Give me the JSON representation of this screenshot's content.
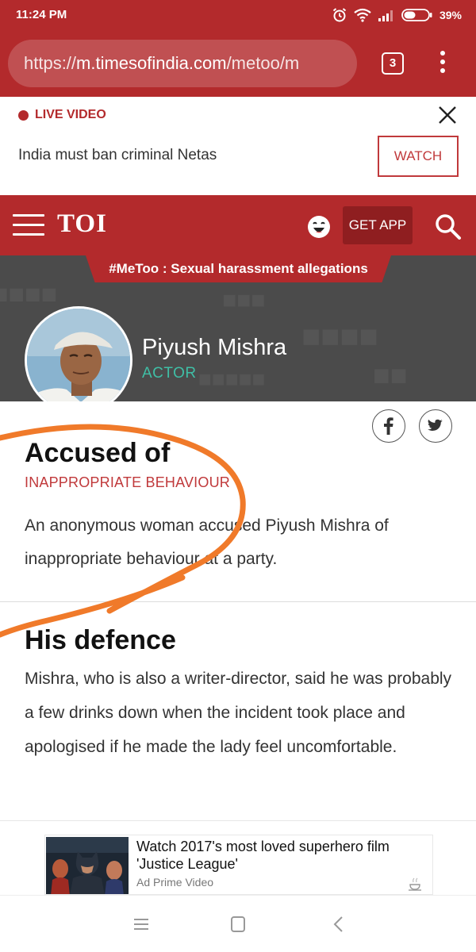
{
  "status_bar": {
    "time": "11:24 PM",
    "battery": "39%",
    "icons": [
      "alarm-icon",
      "wifi-icon",
      "signal-icon",
      "battery-icon"
    ]
  },
  "browser": {
    "url_scheme": "https://",
    "url_host": "m.timesofindia.com",
    "url_path": "/metoo/m",
    "tab_count": "3",
    "icons": [
      "tabs-icon",
      "more-vert-icon"
    ]
  },
  "live_banner": {
    "label": "LIVE VIDEO",
    "headline": "India must ban criminal Netas",
    "watch_label": "WATCH",
    "icons": [
      "live-dot-icon",
      "close-icon"
    ]
  },
  "header": {
    "logo": "TOI",
    "get_app_label": "GET APP",
    "icons": [
      "hamburger-icon",
      "laughing-emoji-icon",
      "search-icon"
    ]
  },
  "hero": {
    "topic": "#MeToo : Sexual harassment allegations",
    "name": "Piyush Mishra",
    "role": "ACTOR"
  },
  "share": {
    "icons": [
      "facebook-icon",
      "twitter-icon"
    ]
  },
  "article": {
    "accused_heading": "Accused of",
    "accused_sub": "INAPPROPRIATE BEHAVIOUR",
    "accused_body": "An anonymous woman accused Piyush Mishra of inappropriate behaviour at a party.",
    "defence_heading": "His defence",
    "defence_body": "Mishra, who is also a writer-director, said he was probably a few drinks down when the incident took place and apologised if he made the lady feel uncomfortable."
  },
  "ad": {
    "title": "Watch 2017's most loved superhero film 'Justice League'",
    "source": "Ad Prime Video"
  },
  "nav_bar": {
    "icons": [
      "menu-icon",
      "home-icon",
      "back-icon"
    ]
  },
  "colors": {
    "brand_red": "#b32a2c",
    "dark_red": "#8f1e20",
    "accent_teal": "#3fbfa6",
    "annotation_orange": "#f07a2a"
  }
}
